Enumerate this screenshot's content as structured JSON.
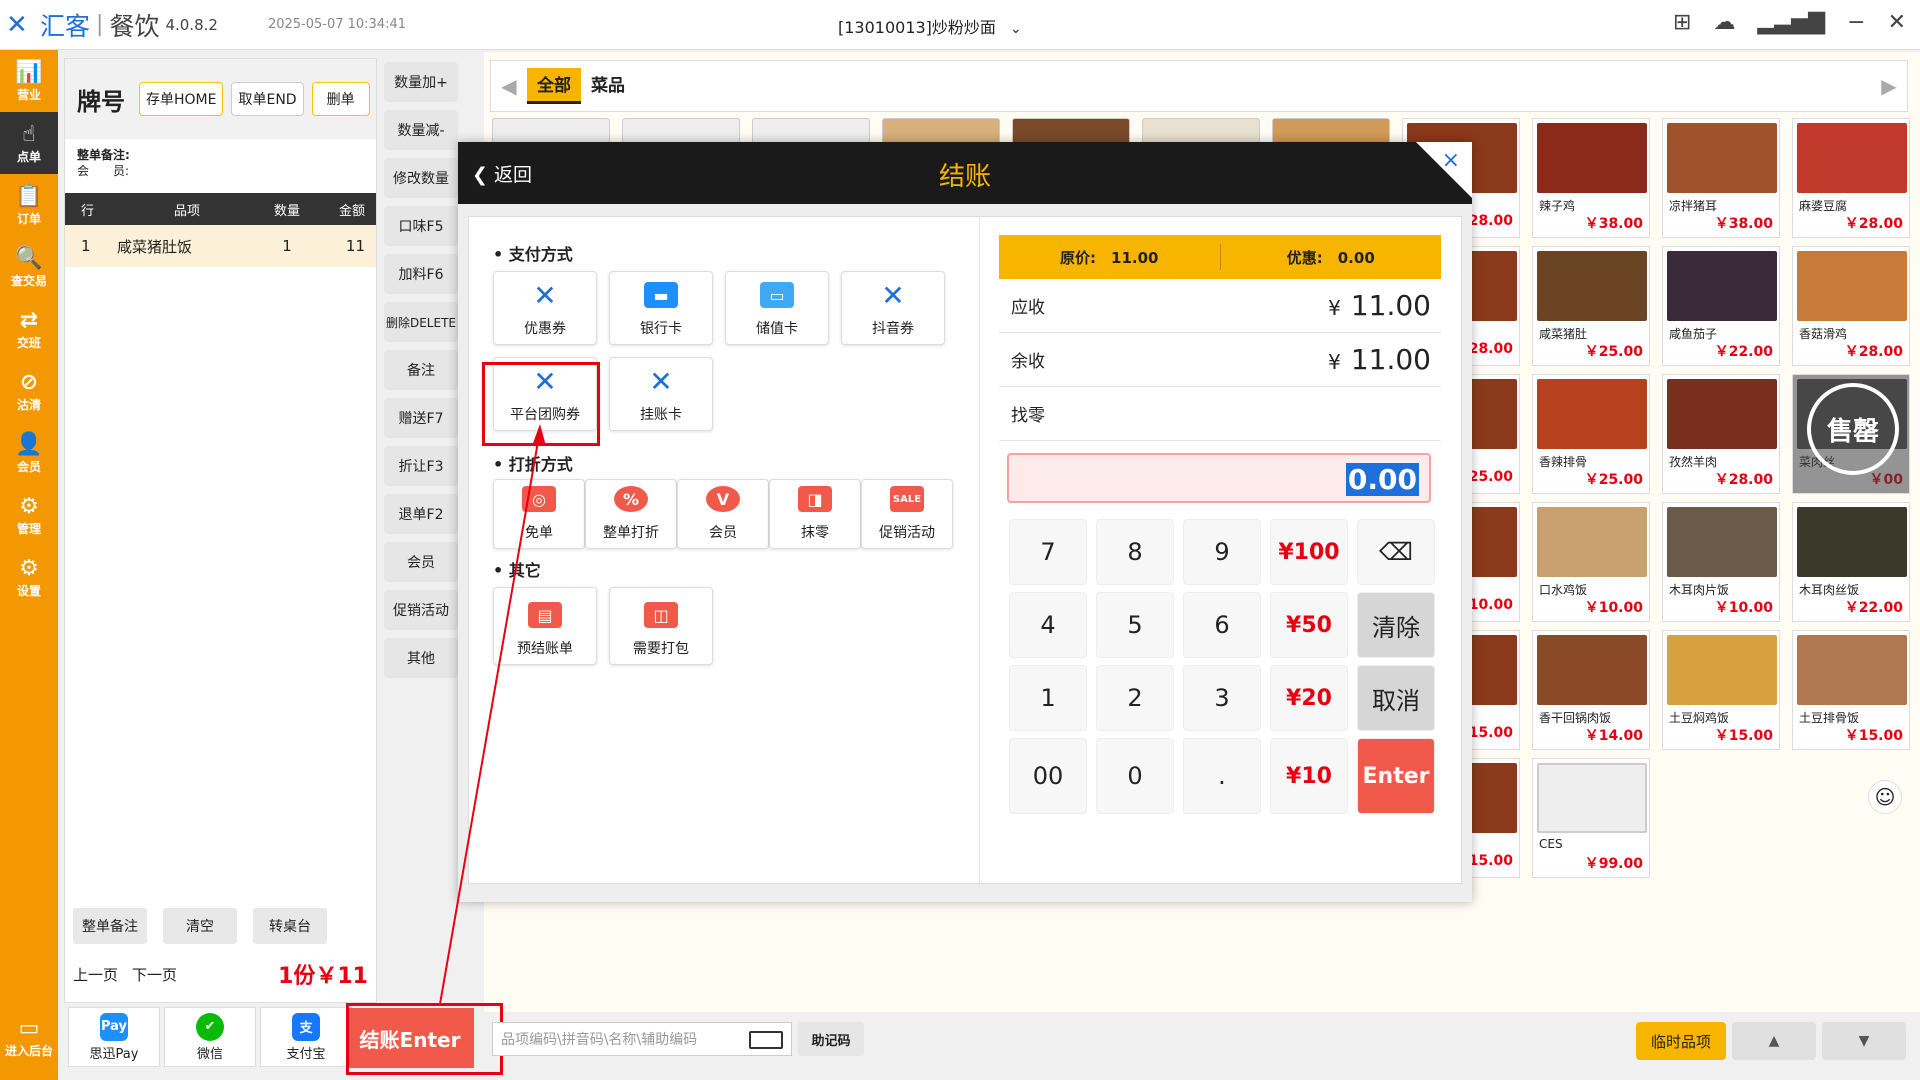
{
  "titlebar": {
    "logo": "汇客",
    "product": "餐饮",
    "version": "4.0.8.2",
    "datetime": "2025-05-07 10:34:41",
    "store": "[13010013]炒粉炒面"
  },
  "nav": [
    {
      "label": "营业",
      "icon": "📊"
    },
    {
      "label": "点单",
      "icon": "☝"
    },
    {
      "label": "订单",
      "icon": "📋"
    },
    {
      "label": "查交易",
      "icon": "🔍"
    },
    {
      "label": "交班",
      "icon": "⇄"
    },
    {
      "label": "沽清",
      "icon": "⊘"
    },
    {
      "label": "会员",
      "icon": "👤"
    },
    {
      "label": "管理",
      "icon": "⚙"
    },
    {
      "label": "设置",
      "icon": "⚙"
    }
  ],
  "nav_bottom": {
    "label": "进入后台",
    "icon": "▭"
  },
  "order": {
    "title": "牌号",
    "store_home": "存单HOME",
    "fetch_end": "取单END",
    "delete": "删单",
    "note_label": "整单备注:",
    "member_label": "会　　员:",
    "headers": [
      "行",
      "品项",
      "数量",
      "金额"
    ],
    "rows": [
      {
        "no": "1",
        "name": "咸菜猪肚饭",
        "qty": "1",
        "amount": "11"
      }
    ],
    "foot_note": "整单备注",
    "foot_clear": "清空",
    "foot_transfer": "转桌台",
    "prev": "上一页",
    "next": "下一页",
    "total": "1份￥11"
  },
  "func": [
    "数量加+",
    "数量减-",
    "修改数量",
    "口味F5",
    "加料F6",
    "删除DELETE",
    "备注",
    "赠送F7",
    "折让F3",
    "退单F2",
    "会员",
    "促销活动",
    "其他"
  ],
  "pay": [
    {
      "label": "思迅Pay",
      "icon": "Pay",
      "color": "#1e8fff"
    },
    {
      "label": "微信",
      "icon": "✔",
      "color": "#09bb07"
    },
    {
      "label": "支付宝",
      "icon": "支",
      "color": "#1677ff"
    }
  ],
  "checkout": "结账Enter",
  "search": {
    "placeholder": "品项编码\\拼音码\\名称\\辅助编码",
    "memo": "助记码"
  },
  "temp_item": "临时品项",
  "categories": {
    "all": "全部",
    "dish": "菜品"
  },
  "dishes": [
    {
      "name": "辣子鸡",
      "price": "￥38.00"
    },
    {
      "name": "凉拌猪耳",
      "price": "￥38.00"
    },
    {
      "name": "麻婆豆腐",
      "price": "￥28.00"
    },
    {
      "name": "咸菜猪肚",
      "price": "￥25.00"
    },
    {
      "name": "咸鱼茄子",
      "price": "￥22.00"
    },
    {
      "name": "香菇滑鸡",
      "price": "￥28.00"
    },
    {
      "name": "香辣排骨",
      "price": "￥25.00"
    },
    {
      "name": "孜然羊肉",
      "price": "￥28.00"
    },
    {
      "name": "菜肉丝",
      "price": "￥00",
      "sold": "售罄"
    },
    {
      "name": "口水鸡饭",
      "price": "￥10.00"
    },
    {
      "name": "木耳肉片饭",
      "price": "￥10.00"
    },
    {
      "name": "木耳肉丝饭",
      "price": "￥22.00"
    },
    {
      "name": "香干回锅肉饭",
      "price": "￥14.00"
    },
    {
      "name": "土豆焖鸡饭",
      "price": "￥15.00"
    },
    {
      "name": "土豆排骨饭",
      "price": "￥15.00"
    },
    {
      "name": "CES",
      "price": "￥99.00"
    }
  ],
  "partial_prices": [
    "28.00",
    "28.00",
    "25.00",
    "10.00",
    "15.00",
    "15.00"
  ],
  "dialog": {
    "back": "返回",
    "title": "结账",
    "close": "×",
    "section_pay": "支付方式",
    "section_discount": "打折方式",
    "section_other": "其它",
    "pay_methods": [
      {
        "label": "优惠券",
        "icon": "✕",
        "color": "#1e6fd9"
      },
      {
        "label": "银行卡",
        "icon": "▬",
        "color": "#1e8fff"
      },
      {
        "label": "储值卡",
        "icon": "▭",
        "color": "#3fa9f5"
      },
      {
        "label": "抖音券",
        "icon": "✕",
        "color": "#1e6fd9"
      },
      {
        "label": "平台团购券",
        "icon": "✕",
        "color": "#1e6fd9"
      },
      {
        "label": "挂账卡",
        "icon": "✕",
        "color": "#1e6fd9"
      }
    ],
    "discounts": [
      {
        "label": "免单",
        "icon": "◎"
      },
      {
        "label": "整单打折",
        "icon": "%"
      },
      {
        "label": "会员",
        "icon": "V"
      },
      {
        "label": "抹零",
        "icon": "◨"
      },
      {
        "label": "促销活动",
        "icon": "SALE"
      }
    ],
    "others": [
      {
        "label": "预结账单",
        "icon": "▤"
      },
      {
        "label": "需要打包",
        "icon": "◫"
      }
    ],
    "original_label": "原价:",
    "original_value": "11.00",
    "discount_label": "优惠:",
    "discount_value": "0.00",
    "receivable_label": "应收",
    "receivable_value": "11.00",
    "remaining_label": "余收",
    "remaining_value": "11.00",
    "change_label": "找零",
    "yen": "¥",
    "input_value": "0.00",
    "keys": [
      "7",
      "8",
      "9",
      "¥100",
      "⌫",
      "4",
      "5",
      "6",
      "¥50",
      "清除",
      "1",
      "2",
      "3",
      "¥20",
      "取消",
      "00",
      "0",
      ".",
      "¥10",
      "Enter"
    ]
  }
}
